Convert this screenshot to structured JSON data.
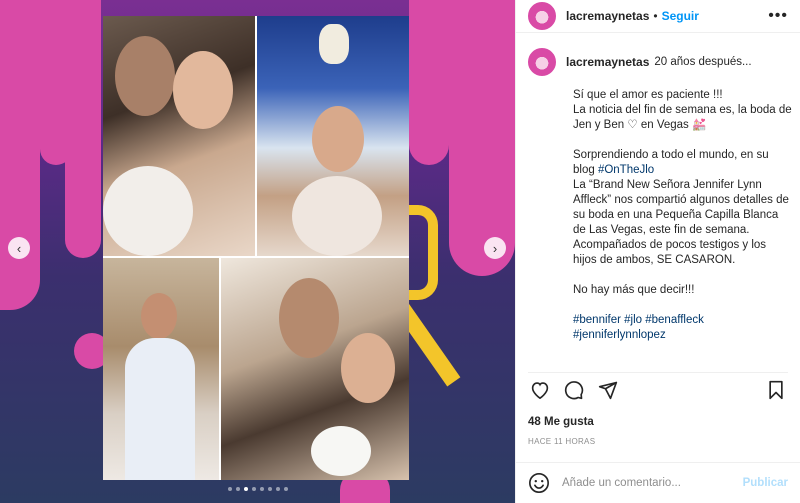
{
  "post": {
    "username": "lacremaynetas",
    "separator": "•",
    "follow_label": "Seguir",
    "more_icon": "•••",
    "caption_title": "20 años después...",
    "caption_body": "Sí que el amor es paciente !!!\nLa noticia del fin de semana es, la boda de Jen y Ben ♡ en Vegas 💒\n\nSorprendiendo a todo el mundo, en su blog ",
    "caption_tag1": "#OnTheJlo",
    "caption_body2": "\nLa “Brand New Señora Jennifer Lynn Affleck” nos compartió algunos detalles de su boda en una Pequeña Capilla Blanca de Las Vegas, este fin de semana. Acompañados de pocos testigos y los hijos de ambos, SE CASARON.\n\nNo hay más que decir!!!\n\n",
    "hashtags": "#bennifer #jlo #benaffleck\n#jenniferlynnlopez",
    "likes": "48 Me gusta",
    "timestamp": "HACE 11 HORAS",
    "comment_placeholder": "Añade un comentario...",
    "publish_label": "Publicar"
  },
  "carousel": {
    "prev_icon": "‹",
    "next_icon": "›",
    "slide_count": 8,
    "active_slide": 2
  },
  "colors": {
    "accent_link": "#0095f6",
    "brand_pink": "#d94aa6",
    "brand_yellow": "#f3c52a"
  }
}
